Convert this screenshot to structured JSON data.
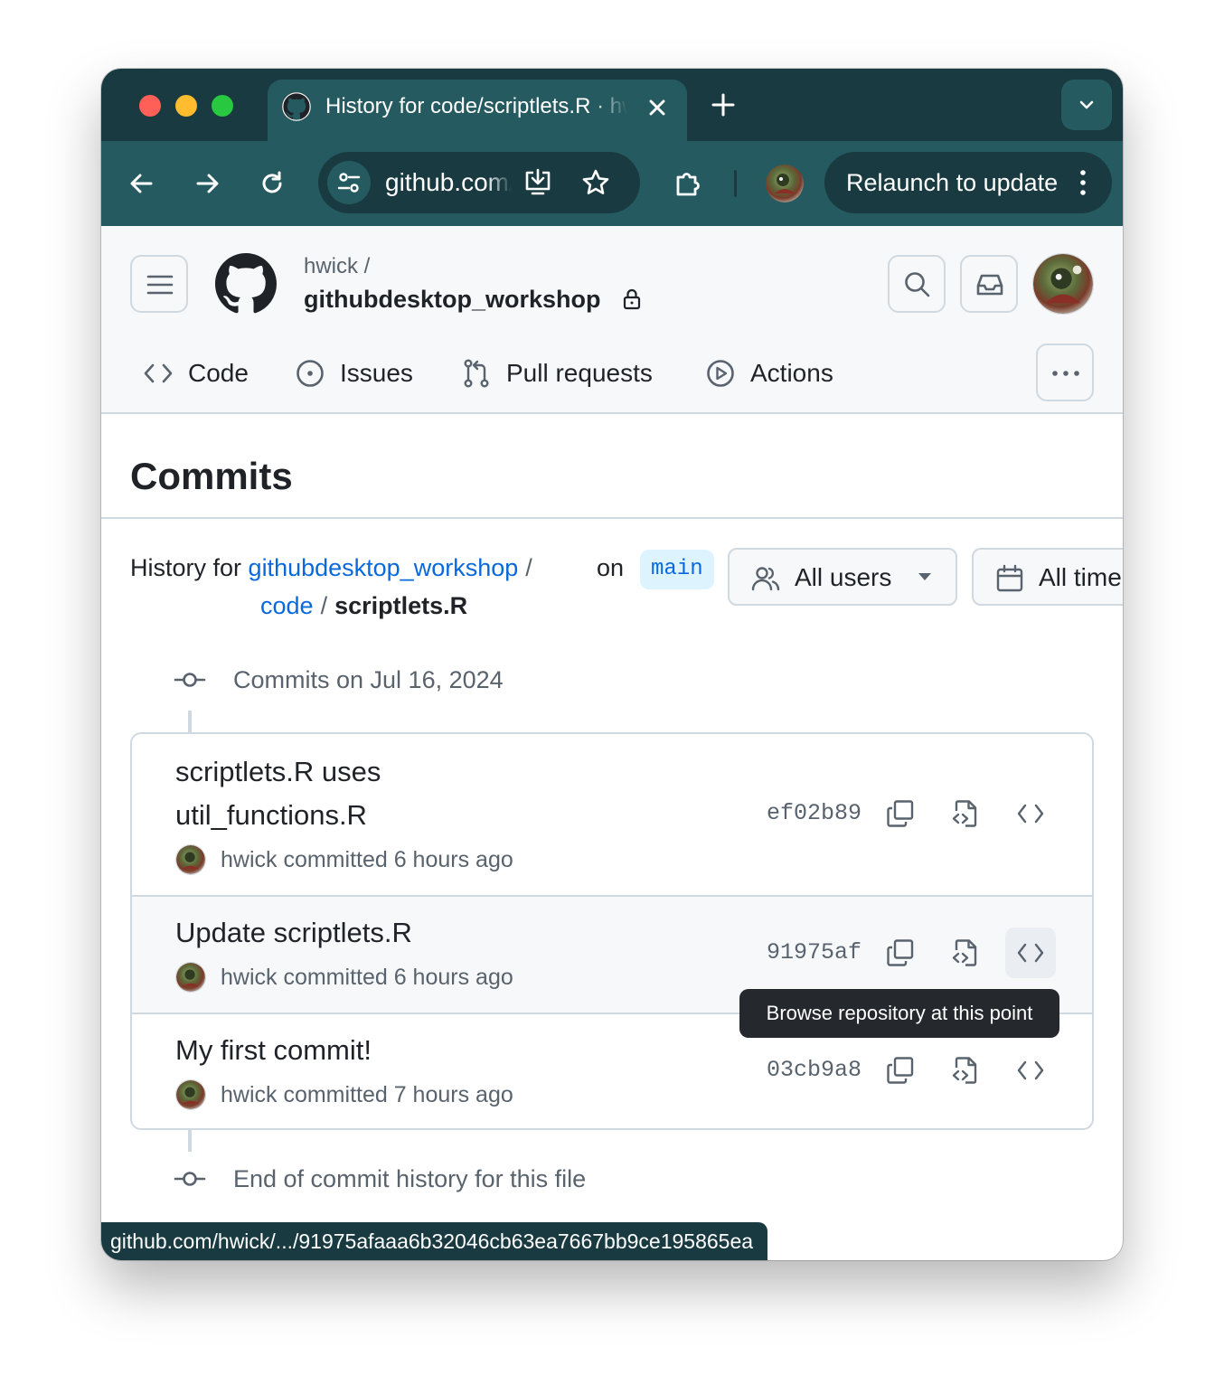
{
  "browser": {
    "tab_title": "History for code/scriptlets.R · hwick/githubdesktop_workshop",
    "omnibox_text": "github.com/hwick/githubdesktop_workshop/commits/main/code/scriptlets.R",
    "relaunch_label": "Relaunch to update",
    "status_url": "github.com/hwick/.../91975afaaa6b32046cb63ea7667bb9ce195865ea"
  },
  "repo": {
    "owner": "hwick /",
    "name": "githubdesktop_workshop"
  },
  "nav": [
    {
      "label": "Code",
      "icon": "code-icon"
    },
    {
      "label": "Issues",
      "icon": "issue-opened-icon"
    },
    {
      "label": "Pull requests",
      "icon": "git-pull-request-icon"
    },
    {
      "label": "Actions",
      "icon": "play-icon"
    }
  ],
  "page": {
    "title": "Commits",
    "history_prefix": "History for",
    "path_repo": "githubdesktop_workshop",
    "path_sep": "/",
    "path_dir": "code",
    "path_file": "scriptlets.R",
    "on_label": "on",
    "branch": "main"
  },
  "filters": {
    "users": "All users",
    "time": "All time"
  },
  "timeline": {
    "group_heading": "Commits on Jul 16, 2024",
    "end_text": "End of commit history for this file"
  },
  "commits": [
    {
      "message_line1": "scriptlets.R uses",
      "message_line2": "util_functions.R",
      "author_line": "hwick committed 6 hours ago",
      "sha": "ef02b89"
    },
    {
      "message_line1": "Update scriptlets.R",
      "author_line": "hwick committed 6 hours ago",
      "sha": "91975af"
    },
    {
      "message_line1": "My first commit!",
      "author_line": "hwick committed 7 hours ago",
      "sha": "03cb9a8"
    }
  ],
  "tooltip": "Browse repository at this point",
  "colors": {
    "chrome_dark": "#183a40",
    "chrome_tab": "#255b60",
    "link": "#0969da",
    "branch_bg": "#ddf4ff",
    "border": "#d1d9e0",
    "muted": "#59636e"
  }
}
